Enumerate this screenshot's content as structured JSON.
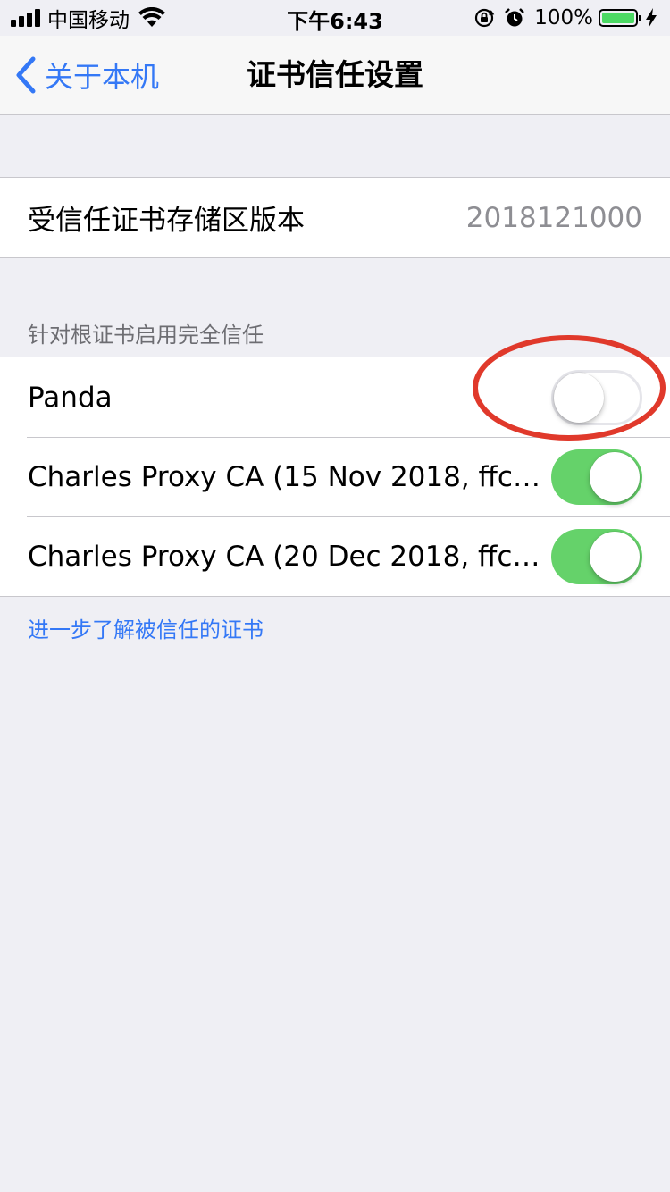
{
  "status_bar": {
    "carrier": "中国移动",
    "time": "下午6:43",
    "battery_percent": "100%",
    "battery_color": "#4cd964",
    "icons": [
      "signal-icon",
      "wifi-icon",
      "rotation-lock-icon",
      "alarm-icon",
      "battery-icon",
      "charging-icon"
    ]
  },
  "nav": {
    "back_label": "关于本机",
    "title": "证书信任设置",
    "accent_color": "#3478f6"
  },
  "store_version": {
    "label": "受信任证书存储区版本",
    "value": "2018121000"
  },
  "trust_section": {
    "header": "针对根证书启用完全信任",
    "items": [
      {
        "label": "Panda",
        "enabled": false
      },
      {
        "label": "Charles Proxy CA (15 Nov 2018, ffcn...",
        "enabled": true
      },
      {
        "label": "Charles Proxy CA (20 Dec 2018, ffcn...",
        "enabled": true
      }
    ],
    "footer_link": "进一步了解被信任的证书"
  },
  "annotation": {
    "shape": "ellipse",
    "color": "#e0392b",
    "target": "Panda"
  },
  "switch_on_color": "#65d26a"
}
